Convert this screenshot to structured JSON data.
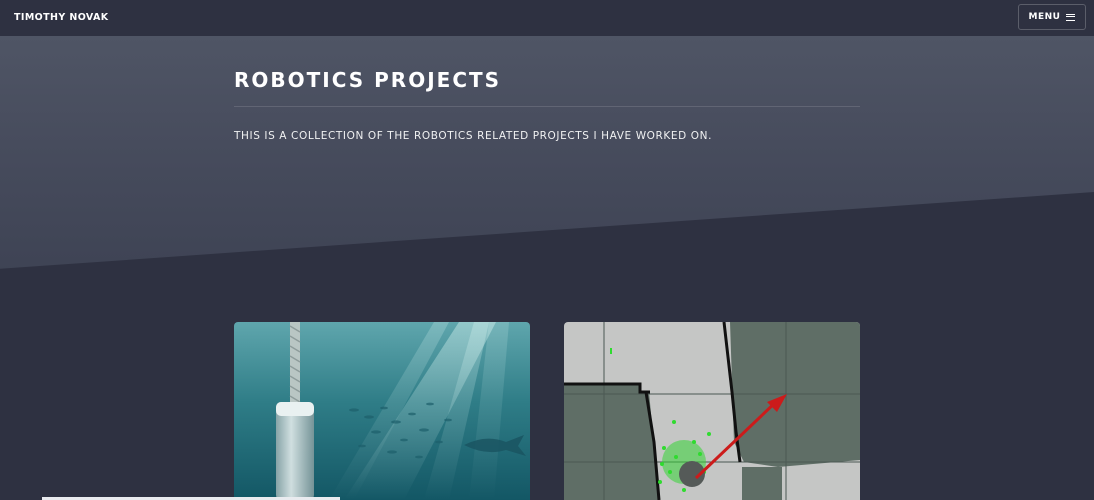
{
  "header": {
    "brand": "TIMOTHY NOVAK",
    "menu_label": "MENU",
    "menu_icon": "hamburger-menu-icon"
  },
  "banner": {
    "title": "ROBOTICS PROJECTS",
    "intro": "THIS IS A COLLECTION OF THE ROBOTICS RELATED PROJECTS I HAVE WORKED ON."
  },
  "projects": [
    {
      "image": "underwater-tether-photo"
    },
    {
      "image": "occupancy-grid-map"
    }
  ],
  "colors": {
    "background": "#2e3141",
    "banner": "#4f5565",
    "text": "#ffffff"
  }
}
